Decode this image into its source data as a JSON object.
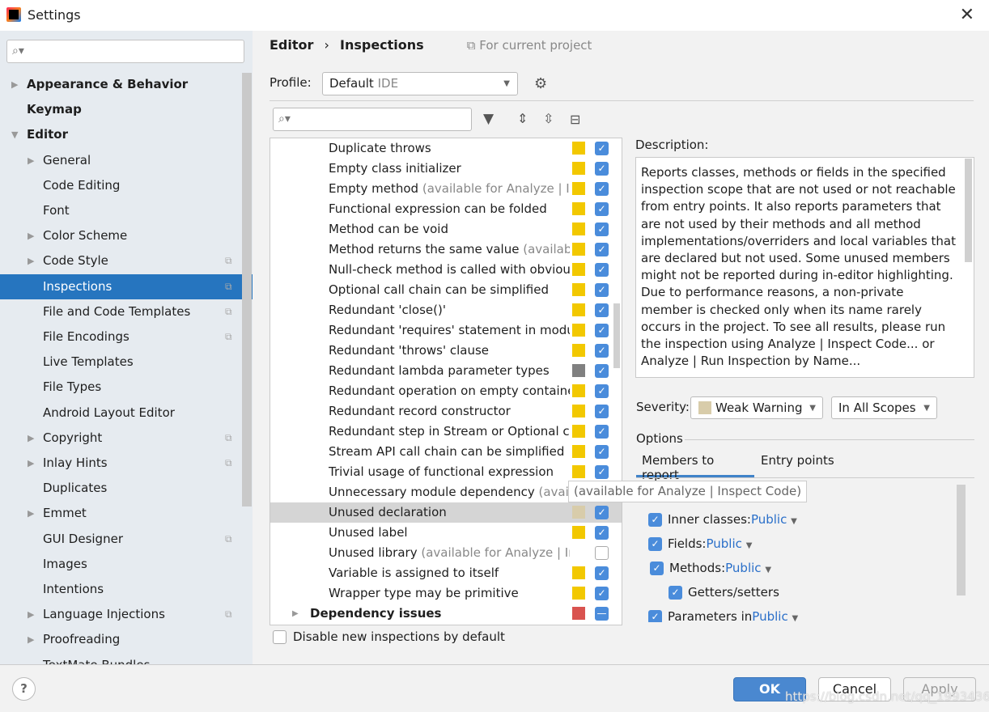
{
  "window": {
    "title": "Settings",
    "close": "✕"
  },
  "sidebar": {
    "search_placeholder": "",
    "items": [
      {
        "label": "Appearance & Behavior",
        "level": 0,
        "bold": true,
        "arrow": "▶",
        "copy": false
      },
      {
        "label": "Keymap",
        "level": 0,
        "bold": true,
        "arrow": "",
        "copy": false
      },
      {
        "label": "Editor",
        "level": 0,
        "bold": true,
        "arrow": "▼",
        "copy": false
      },
      {
        "label": "General",
        "level": 1,
        "arrow": "▶",
        "copy": false
      },
      {
        "label": "Code Editing",
        "level": 1,
        "arrow": "",
        "copy": false
      },
      {
        "label": "Font",
        "level": 1,
        "arrow": "",
        "copy": false
      },
      {
        "label": "Color Scheme",
        "level": 1,
        "arrow": "▶",
        "copy": false
      },
      {
        "label": "Code Style",
        "level": 1,
        "arrow": "▶",
        "copy": true
      },
      {
        "label": "Inspections",
        "level": 1,
        "arrow": "",
        "copy": true,
        "selected": true
      },
      {
        "label": "File and Code Templates",
        "level": 1,
        "arrow": "",
        "copy": true
      },
      {
        "label": "File Encodings",
        "level": 1,
        "arrow": "",
        "copy": true
      },
      {
        "label": "Live Templates",
        "level": 1,
        "arrow": "",
        "copy": false
      },
      {
        "label": "File Types",
        "level": 1,
        "arrow": "",
        "copy": false
      },
      {
        "label": "Android Layout Editor",
        "level": 1,
        "arrow": "",
        "copy": false
      },
      {
        "label": "Copyright",
        "level": 1,
        "arrow": "▶",
        "copy": true
      },
      {
        "label": "Inlay Hints",
        "level": 1,
        "arrow": "▶",
        "copy": true
      },
      {
        "label": "Duplicates",
        "level": 1,
        "arrow": "",
        "copy": false
      },
      {
        "label": "Emmet",
        "level": 1,
        "arrow": "▶",
        "copy": false
      },
      {
        "label": "GUI Designer",
        "level": 1,
        "arrow": "",
        "copy": true
      },
      {
        "label": "Images",
        "level": 1,
        "arrow": "",
        "copy": false
      },
      {
        "label": "Intentions",
        "level": 1,
        "arrow": "",
        "copy": false
      },
      {
        "label": "Language Injections",
        "level": 1,
        "arrow": "▶",
        "copy": true
      },
      {
        "label": "Proofreading",
        "level": 1,
        "arrow": "▶",
        "copy": false
      },
      {
        "label": "TextMate Bundles",
        "level": 1,
        "arrow": "",
        "copy": false
      }
    ]
  },
  "breadcrumb": {
    "parent": "Editor",
    "sep": "›",
    "current": "Inspections",
    "scope": "For current project"
  },
  "profile": {
    "label": "Profile:",
    "value": "Default",
    "suffix": "IDE"
  },
  "inspections": [
    {
      "name": "Duplicate throws",
      "note": "",
      "color": "#f2c800",
      "checked": true
    },
    {
      "name": "Empty class initializer",
      "note": "",
      "color": "#f2c800",
      "checked": true
    },
    {
      "name": "Empty method",
      "note": " (available for Analyze | Inspect Code)",
      "color": "#f2c800",
      "checked": true
    },
    {
      "name": "Functional expression can be folded",
      "note": "",
      "color": "#f2c800",
      "checked": true
    },
    {
      "name": "Method can be void",
      "note": "",
      "color": "#f2c800",
      "checked": true
    },
    {
      "name": "Method returns the same value",
      "note": " (available for Analyze | Inspect Code)",
      "color": "#f2c800",
      "checked": true
    },
    {
      "name": "Null-check method is called with obviously non-null argument",
      "note": "",
      "color": "#f2c800",
      "checked": true
    },
    {
      "name": "Optional call chain can be simplified",
      "note": "",
      "color": "#f2c800",
      "checked": true
    },
    {
      "name": "Redundant 'close()'",
      "note": "",
      "color": "#f2c800",
      "checked": true
    },
    {
      "name": "Redundant 'requires' statement in module-info",
      "note": "",
      "color": "#f2c800",
      "checked": true
    },
    {
      "name": "Redundant 'throws' clause",
      "note": "",
      "color": "#f2c800",
      "checked": true
    },
    {
      "name": "Redundant lambda parameter types",
      "note": "",
      "color": "#808080",
      "checked": true
    },
    {
      "name": "Redundant operation on empty container",
      "note": "",
      "color": "#f2c800",
      "checked": true
    },
    {
      "name": "Redundant record constructor",
      "note": "",
      "color": "#f2c800",
      "checked": true
    },
    {
      "name": "Redundant step in Stream or Optional call chain",
      "note": "",
      "color": "#f2c800",
      "checked": true
    },
    {
      "name": "Stream API call chain can be simplified",
      "note": "",
      "color": "#f2c800",
      "checked": true
    },
    {
      "name": "Trivial usage of functional expression",
      "note": "",
      "color": "#f2c800",
      "checked": true
    },
    {
      "name": "Unnecessary module dependency",
      "note": " (available for Analyze | Inspect Code)",
      "color": "",
      "checked": null
    },
    {
      "name": "Unused declaration",
      "note": "",
      "color": "#d8ccaa",
      "checked": true,
      "selected": true
    },
    {
      "name": "Unused label",
      "note": "",
      "color": "#f2c800",
      "checked": true
    },
    {
      "name": "Unused library",
      "note": " (available for Analyze | Inspect Code)",
      "color": "",
      "checked": false
    },
    {
      "name": "Variable is assigned to itself",
      "note": "",
      "color": "#f2c800",
      "checked": true
    },
    {
      "name": "Wrapper type may be primitive",
      "note": "",
      "color": "#f2c800",
      "checked": true
    }
  ],
  "group": {
    "name": "Dependency issues",
    "color": "#d9534f"
  },
  "disable_new": "Disable new inspections by default",
  "description": {
    "label": "Description:",
    "text": "Reports classes, methods or fields in the specified inspection scope that are not used or not reachable from entry points. It also reports parameters that are not used by their methods and all method implementations/overriders and local variables that are declared but not used. Some unused members might not be reported during in-editor highlighting. Due to performance reasons, a non-private member is checked only when its name rarely occurs in the project. To see all results, please run the inspection using Analyze | Inspect Code... or Analyze | Run Inspection by Name..."
  },
  "severity": {
    "label": "Severity:",
    "value": "Weak Warning",
    "color": "#d8ccaa",
    "scope": "In All Scopes"
  },
  "options": {
    "label": "Options",
    "tabs": [
      "Members to report",
      "Entry points"
    ],
    "items": [
      {
        "label": "Inner classes:",
        "value": "Public"
      },
      {
        "label": "Fields:",
        "value": "Public"
      },
      {
        "label": "Methods:",
        "value": "Public"
      },
      {
        "label": "Getters/setters",
        "value": ""
      },
      {
        "label": "Parameters in",
        "value": "Public"
      }
    ],
    "partial": "c"
  },
  "tooltip": "(available for Analyze | Inspect Code)",
  "buttons": {
    "help": "?",
    "ok": "OK",
    "cancel": "Cancel",
    "apply": "Apply"
  },
  "watermark": "https://blog.csdn.net/qq_19934363"
}
